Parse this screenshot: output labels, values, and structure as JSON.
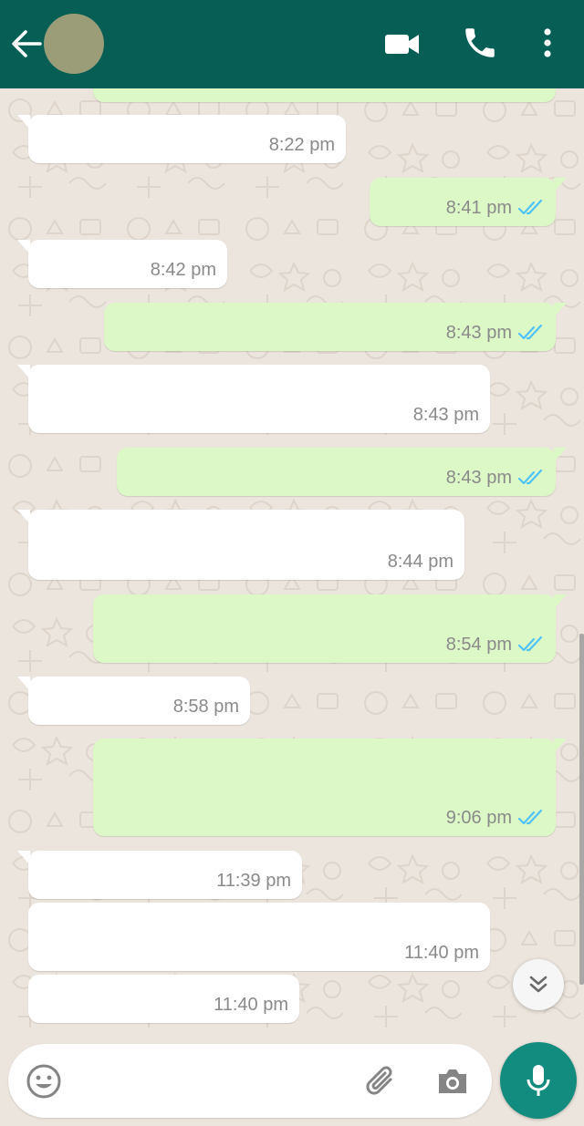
{
  "colors": {
    "header": "#075e54",
    "chat_background": "#ece5dd",
    "incoming_bubble": "#ffffff",
    "outgoing_bubble": "#dcf8c6",
    "read_ticks": "#4fc3f7",
    "mic_button": "#128c7e"
  },
  "header": {
    "back_icon": "arrow-left-icon",
    "avatar": "contact-avatar",
    "actions": [
      "video-camera-icon",
      "phone-icon",
      "more-vertical-icon"
    ]
  },
  "messages": [
    {
      "direction": "out",
      "time": "",
      "status": ""
    },
    {
      "direction": "in",
      "time": "8:22 pm"
    },
    {
      "direction": "out",
      "time": "8:41 pm",
      "status": "read"
    },
    {
      "direction": "in",
      "time": "8:42 pm"
    },
    {
      "direction": "out",
      "time": "8:43 pm",
      "status": "read"
    },
    {
      "direction": "in",
      "time": "8:43 pm"
    },
    {
      "direction": "out",
      "time": "8:43 pm",
      "status": "read"
    },
    {
      "direction": "in",
      "time": "8:44 pm"
    },
    {
      "direction": "out",
      "time": "8:54 pm",
      "status": "read"
    },
    {
      "direction": "in",
      "time": "8:58 pm"
    },
    {
      "direction": "out",
      "time": "9:06 pm",
      "status": "read"
    },
    {
      "direction": "in",
      "time": "11:39 pm"
    },
    {
      "direction": "in",
      "time": "11:40 pm"
    },
    {
      "direction": "in",
      "time": "11:40 pm"
    }
  ],
  "scroll_to_bottom_icon": "double-chevron-down-icon",
  "composer": {
    "placeholder": "",
    "value": "",
    "icons": [
      "emoji-icon",
      "paperclip-icon",
      "camera-icon",
      "microphone-icon"
    ]
  }
}
